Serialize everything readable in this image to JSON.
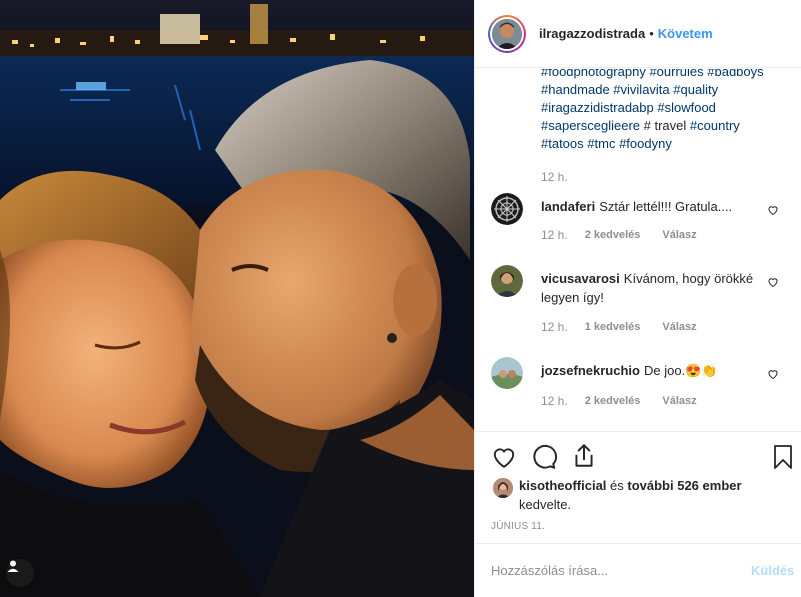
{
  "post": {
    "username": "ilragazzodistrada",
    "separator": "•",
    "follow_label": "Követem"
  },
  "caption": {
    "lines": [
      [
        "#foodphotography",
        "#ourrules",
        "#badboys"
      ],
      [
        "#handmade",
        "#vivilavita",
        "#quality"
      ],
      [
        "#iragazzidistradabp",
        "#slowfood"
      ],
      [
        "#sapersceglieere",
        "# travel",
        "#country"
      ],
      [
        "#tatoos",
        "#tmc",
        "#foodyny"
      ]
    ],
    "time": "12 h."
  },
  "comments": [
    {
      "user": "landaferi",
      "text": "Sztár lettél!!! Gratula....",
      "time": "12 h.",
      "likes": "2 kedvelés",
      "reply": "Válasz"
    },
    {
      "user": "vicusavarosi",
      "text": "Kívánom, hogy örökké legyen így!",
      "time": "12 h.",
      "likes": "1 kedvelés",
      "reply": "Válasz"
    },
    {
      "user": "jozsefnekruchio",
      "text": "De joo.😍👏",
      "time": "12 h.",
      "likes": "2 kedvelés",
      "reply": "Válasz"
    }
  ],
  "likes": {
    "user": "kisotheofficial",
    "middle": " és ",
    "others": "további 526 ember",
    "suffix": " kedvelte."
  },
  "date": "JÚNIUS 11.",
  "add_comment": {
    "placeholder": "Hozzászólás írása...",
    "send_label": "Küldés"
  },
  "icons": {
    "like": "heart-icon",
    "comment": "comment-bubble-icon",
    "share": "share-icon",
    "save": "bookmark-icon",
    "tag": "user-tag-icon"
  },
  "colors": {
    "accent": "#3897f0",
    "hashtag": "#00376b",
    "muted": "#8e8e8e",
    "send_disabled": "#b2dffc"
  }
}
